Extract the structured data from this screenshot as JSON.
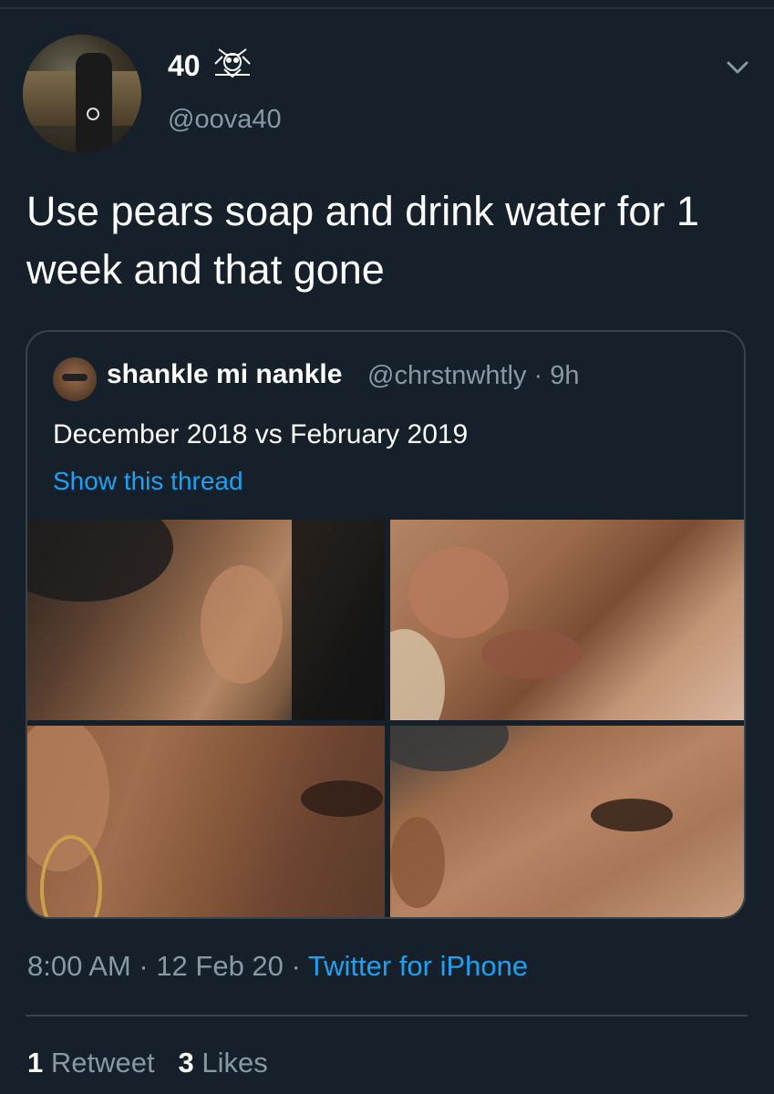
{
  "author": {
    "display_name": "40",
    "handle": "@oova40",
    "badge_icon": "owl-icon"
  },
  "tweet": {
    "text": "Use pears soap and drink water for 1 week and that gone"
  },
  "quoted_tweet": {
    "author_name": "shankle mi nankle",
    "author_handle": "@chrstnwhtly · 9h",
    "text": "December 2018 vs February 2019",
    "thread_link": "Show this thread",
    "photo_count": 4
  },
  "meta": {
    "time": "8:00 AM",
    "separator_1": " · ",
    "date": "12 Feb 20",
    "separator_2": " · ",
    "source": "Twitter for iPhone"
  },
  "stats": {
    "retweets_count": "1",
    "retweets_label": "Retweet",
    "likes_count": "3",
    "likes_label": "Likes"
  },
  "colors": {
    "background": "#15202b",
    "link": "#1da1f2",
    "secondary_text": "#8899a6",
    "border": "#38444d"
  }
}
